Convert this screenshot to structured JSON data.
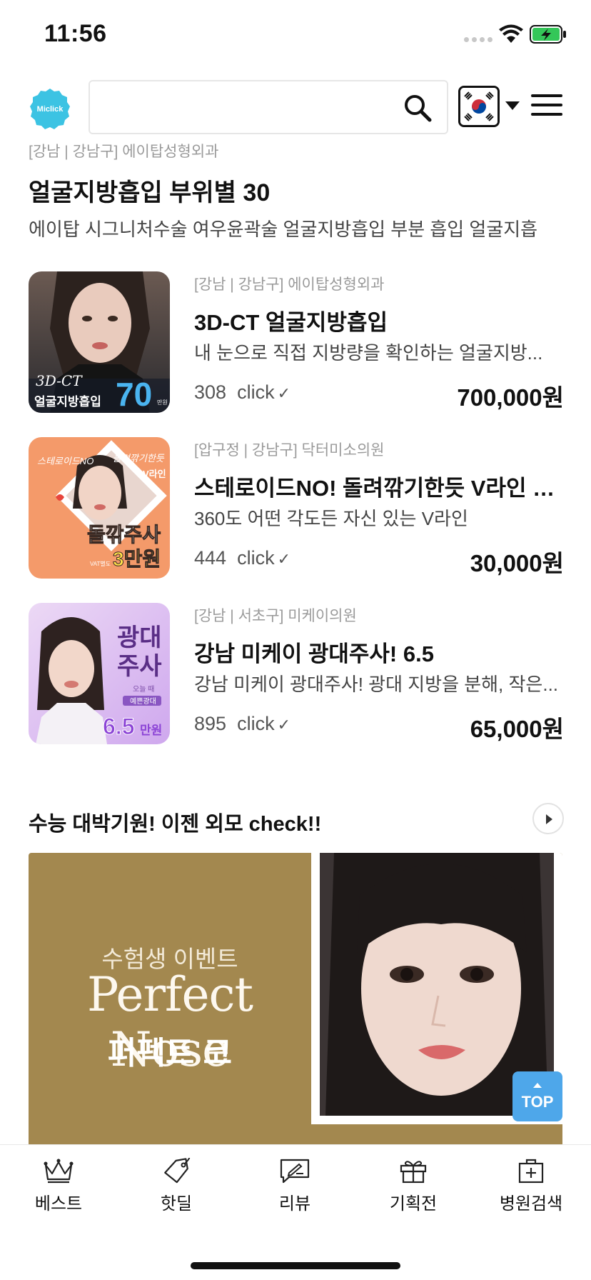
{
  "status": {
    "time": "11:56"
  },
  "header": {
    "logo_text": "Miclick",
    "search": {
      "value": "",
      "placeholder": ""
    },
    "language": "KR"
  },
  "top_item": {
    "meta": "[강남 | 강남구] 에이탑성형외과",
    "title": "얼굴지방흡입 부위별 30",
    "desc": "에이탑 시그니처수술 여우윤곽술 얼굴지방흡입 부분 흡입 얼굴지흡"
  },
  "products": [
    {
      "meta": "[강남 | 강남구] 에이탑성형외과",
      "title": "3D-CT 얼굴지방흡입",
      "desc": "내 눈으로 직접 지방량을 확인하는 얼굴지방...",
      "clicks": "308",
      "click_label": "click",
      "price": "700,000원",
      "thumb_text": [
        "3D-CT",
        "얼굴지방흡입",
        "70",
        "만원"
      ]
    },
    {
      "meta": "[압구정 | 강남구] 닥터미소의원",
      "title": "스테로이드NO! 돌려깎기한듯 V라인 돌...",
      "desc": "360도 어떤 각도든 자신 있는 V라인",
      "clicks": "444",
      "click_label": "click",
      "price": "30,000원",
      "thumb_text": [
        "스테로이드NO",
        "돌려깎기한듯",
        "V라인",
        "돌깎주사",
        "3만원",
        "VAT별도"
      ]
    },
    {
      "meta": "[강남 | 서초구] 미케이의원",
      "title": "강남 미케이 광대주사! 6.5",
      "desc": "강남 미케이 광대주사! 광대 지방을 분해, 작은...",
      "clicks": "895",
      "click_label": "click",
      "price": "65,000원",
      "thumb_text": [
        "광대",
        "주사",
        "오늘 때",
        "예쁜광대",
        "6.5",
        "만원"
      ]
    }
  ],
  "section": {
    "title": "수능 대박기원! 이젠 외모 check!!"
  },
  "banner": {
    "event": "수험생 이벤트",
    "title_en": "Perfect Nose",
    "title_ko": "퍼펙트 코"
  },
  "top_button": "TOP",
  "tabs": [
    {
      "label": "베스트",
      "icon": "crown-icon"
    },
    {
      "label": "핫딜",
      "icon": "tag-icon"
    },
    {
      "label": "리뷰",
      "icon": "review-icon"
    },
    {
      "label": "기획전",
      "icon": "gift-icon"
    },
    {
      "label": "병원검색",
      "icon": "hospital-icon"
    }
  ],
  "colors": {
    "accent": "#4ea7ea",
    "banner_bg": "#a3884f",
    "logo": "#3cc3e3"
  }
}
